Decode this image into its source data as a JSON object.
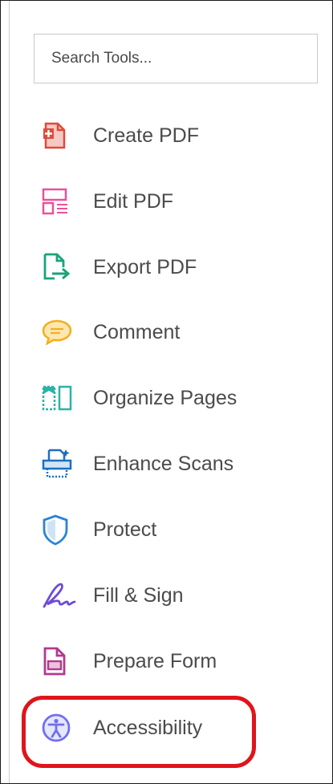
{
  "search": {
    "placeholder": "Search Tools..."
  },
  "tools": [
    {
      "label": "Create PDF",
      "icon": "create-pdf-icon",
      "color": "#e04a3a"
    },
    {
      "label": "Edit PDF",
      "icon": "edit-pdf-icon",
      "color": "#e8529a"
    },
    {
      "label": "Export PDF",
      "icon": "export-pdf-icon",
      "color": "#1aa37a"
    },
    {
      "label": "Comment",
      "icon": "comment-icon",
      "color": "#f2b01e"
    },
    {
      "label": "Organize Pages",
      "icon": "organize-pages-icon",
      "color": "#2bb3a8"
    },
    {
      "label": "Enhance Scans",
      "icon": "enhance-scans-icon",
      "color": "#1c6fbf"
    },
    {
      "label": "Protect",
      "icon": "protect-icon",
      "color": "#2a83d6"
    },
    {
      "label": "Fill & Sign",
      "icon": "fill-sign-icon",
      "color": "#6c4bd8"
    },
    {
      "label": "Prepare Form",
      "icon": "prepare-form-icon",
      "color": "#b23a8f"
    },
    {
      "label": "Accessibility",
      "icon": "accessibility-icon",
      "color": "#6f6ff0"
    }
  ],
  "highlight": {
    "color": "#e0141b",
    "target": "Accessibility"
  }
}
